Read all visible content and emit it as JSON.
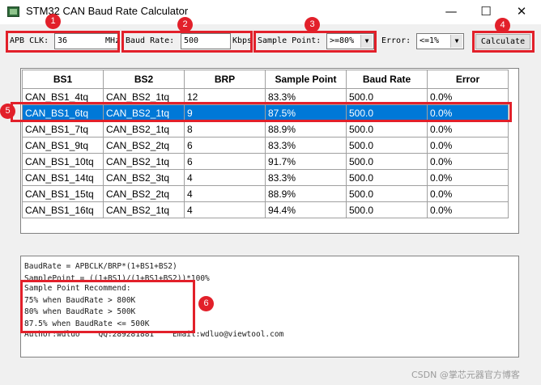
{
  "window": {
    "title": "STM32 CAN Baud Rate Calculator",
    "minimize_glyph": "—",
    "maximize_glyph": "☐",
    "close_glyph": "✕"
  },
  "toolbar": {
    "apb_label": "APB CLK:",
    "apb_value": "36",
    "apb_unit": "MHz",
    "baud_label": "Baud Rate:",
    "baud_value": "500",
    "baud_unit": "Kbps",
    "sample_label": "Sample Point:",
    "sample_value": ">=80%",
    "error_label": "Error:",
    "error_value": "<=1%",
    "dropdown_glyph": "▼",
    "calculate_label": "Calculate"
  },
  "table": {
    "columns": [
      "BS1",
      "BS2",
      "BRP",
      "Sample Point",
      "Baud Rate",
      "Error"
    ],
    "rows": [
      [
        "CAN_BS1_4tq",
        "CAN_BS2_1tq",
        "12",
        "83.3%",
        "500.0",
        "0.0%"
      ],
      [
        "CAN_BS1_6tq",
        "CAN_BS2_1tq",
        "9",
        "87.5%",
        "500.0",
        "0.0%"
      ],
      [
        "CAN_BS1_7tq",
        "CAN_BS2_1tq",
        "8",
        "88.9%",
        "500.0",
        "0.0%"
      ],
      [
        "CAN_BS1_9tq",
        "CAN_BS2_2tq",
        "6",
        "83.3%",
        "500.0",
        "0.0%"
      ],
      [
        "CAN_BS1_10tq",
        "CAN_BS2_1tq",
        "6",
        "91.7%",
        "500.0",
        "0.0%"
      ],
      [
        "CAN_BS1_14tq",
        "CAN_BS2_3tq",
        "4",
        "83.3%",
        "500.0",
        "0.0%"
      ],
      [
        "CAN_BS1_15tq",
        "CAN_BS2_2tq",
        "4",
        "88.9%",
        "500.0",
        "0.0%"
      ],
      [
        "CAN_BS1_16tq",
        "CAN_BS2_1tq",
        "4",
        "94.4%",
        "500.0",
        "0.0%"
      ]
    ],
    "selected_row": 1
  },
  "output": {
    "lines": [
      "BaudRate = APBCLK/BRP*(1+BS1+BS2)",
      "SamplePoint = ((1+BS1)/(1+BS1+BS2))*100%",
      "Sample Point Recommend:",
      "75% when BaudRate > 800K",
      "80% when BaudRate > 500K",
      "87.5% when BaudRate <= 500K",
      "Author:wdluo    QQ:289281881    Email:wdluo@viewtool.com"
    ]
  },
  "annotations": [
    "1",
    "2",
    "3",
    "4",
    "5",
    "6"
  ],
  "watermark": "CSDN @掌芯元器官方博客",
  "colors": {
    "selection": "#0078d7",
    "annotation_red": "#e2202a"
  }
}
